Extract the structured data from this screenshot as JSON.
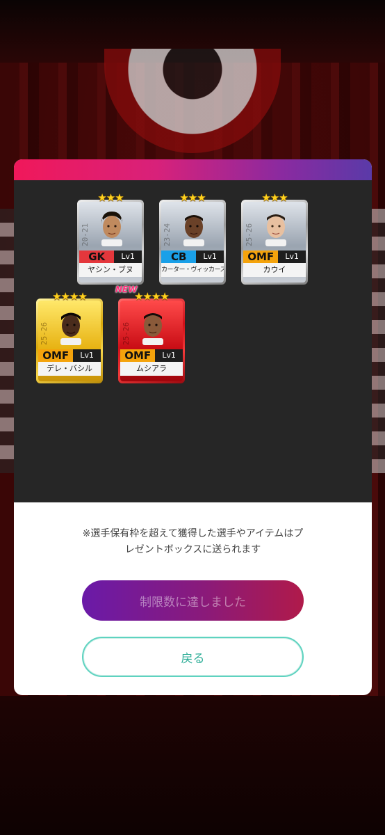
{
  "players": [
    {
      "stars": "★★★",
      "season": "20-21",
      "position": "GK",
      "level": "Lv1",
      "name": "ヤシン・ブヌ"
    },
    {
      "stars": "★★★",
      "season": "23-24",
      "position": "CB",
      "level": "Lv1",
      "name": "カーター・ヴィッカース"
    },
    {
      "stars": "★★★",
      "season": "25-26",
      "position": "OMF",
      "level": "Lv1",
      "name": "カウイ"
    },
    {
      "stars": "★★★★",
      "season": "25-26",
      "position": "OMF",
      "level": "Lv1",
      "name": "デレ・バシル"
    },
    {
      "stars": "★★★★",
      "season": "25-26",
      "position": "OMF",
      "level": "Lv1",
      "name": "ムシアラ",
      "badge": "NEW"
    }
  ],
  "notice": {
    "line1": "※選手保有枠を超えて獲得した選手やアイテムはプ",
    "line2": "レゼントボックスに送られます"
  },
  "buttons": {
    "limit_label": "制限数に達しました",
    "back_label": "戻る"
  },
  "colors": {
    "header_gradient_start": "#f0185a",
    "header_gradient_end": "#5a3aa8",
    "limit_button_start": "#6a1aa8",
    "limit_button_end": "#b01a4a",
    "back_button_accent": "#5ed3c0"
  }
}
